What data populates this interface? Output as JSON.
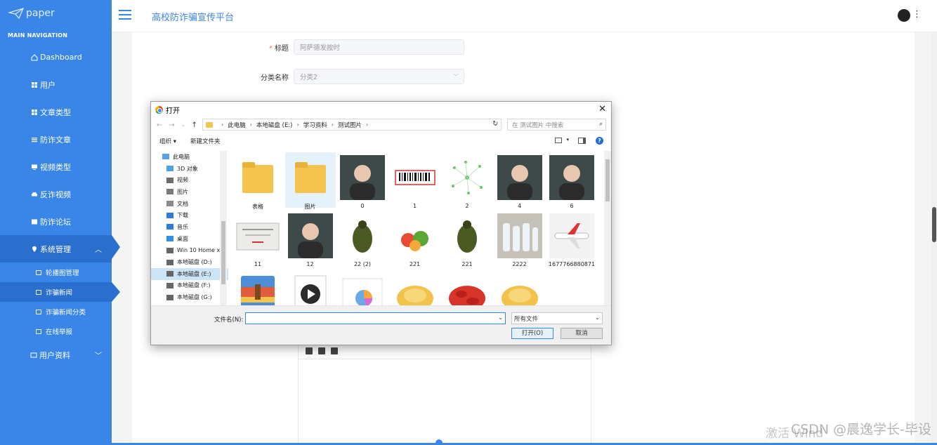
{
  "sidebar": {
    "brand": "paper",
    "nav_header": "MAIN NAVIGATION",
    "items": [
      {
        "label": "Dashboard"
      },
      {
        "label": "用户"
      },
      {
        "label": "文章类型"
      },
      {
        "label": "防诈文章"
      },
      {
        "label": "视频类型"
      },
      {
        "label": "反诈视频"
      },
      {
        "label": "防诈论坛"
      },
      {
        "label": "系统管理"
      }
    ],
    "sub_items": [
      {
        "label": "轮播图管理"
      },
      {
        "label": "诈骗新闻"
      },
      {
        "label": "诈骗新闻分类"
      },
      {
        "label": "在线举报"
      }
    ],
    "user_item": {
      "label": "用户资料"
    }
  },
  "topbar": {
    "title": "高校防诈骗宣传平台"
  },
  "form": {
    "title_label": "标题",
    "title_value": "阿萨德发按时",
    "category_label": "分类名称",
    "category_value": "分类2"
  },
  "dialog": {
    "title": "打开",
    "breadcrumbs": [
      "此电脑",
      "本地磁盘 (E:)",
      "学习资料",
      "测试图片"
    ],
    "search_placeholder": "在 测试图片 中搜索",
    "toolbar": {
      "organize": "组织 ▾",
      "new_folder": "新建文件夹"
    },
    "tree": [
      {
        "label": "此电脑",
        "icon": "computer-icon"
      },
      {
        "label": "3D 对象",
        "icon": "cube-icon"
      },
      {
        "label": "视频",
        "icon": "video-icon"
      },
      {
        "label": "图片",
        "icon": "image-icon"
      },
      {
        "label": "文档",
        "icon": "document-icon"
      },
      {
        "label": "下载",
        "icon": "download-icon"
      },
      {
        "label": "音乐",
        "icon": "music-icon"
      },
      {
        "label": "桌面",
        "icon": "desktop-icon"
      },
      {
        "label": "Win 10 Home x",
        "icon": "drive-icon"
      },
      {
        "label": "本地磁盘 (D:)",
        "icon": "drive-icon"
      },
      {
        "label": "本地磁盘 (E:)",
        "icon": "drive-icon"
      },
      {
        "label": "本地磁盘 (F:)",
        "icon": "drive-icon"
      },
      {
        "label": "本地磁盘 (G:)",
        "icon": "drive-icon"
      }
    ],
    "files": [
      {
        "name": "表格",
        "kind": "folder"
      },
      {
        "name": "图片",
        "kind": "folder"
      },
      {
        "name": "0",
        "kind": "portrait"
      },
      {
        "name": "1",
        "kind": "barcode"
      },
      {
        "name": "2",
        "kind": "graph"
      },
      {
        "name": "4",
        "kind": "portrait"
      },
      {
        "name": "6",
        "kind": "portrait"
      },
      {
        "name": "11",
        "kind": "certificate"
      },
      {
        "name": "12",
        "kind": "portrait"
      },
      {
        "name": "22 (2)",
        "kind": "beetle"
      },
      {
        "name": "221",
        "kind": "vegetables"
      },
      {
        "name": "221",
        "kind": "beetle"
      },
      {
        "name": "2222",
        "kind": "bottles"
      },
      {
        "name": "1677766880871",
        "kind": "airplane"
      },
      {
        "name": "",
        "kind": "archive"
      },
      {
        "name": "",
        "kind": "video"
      },
      {
        "name": "",
        "kind": "chart"
      },
      {
        "name": "",
        "kind": "food"
      },
      {
        "name": "",
        "kind": "crayfish"
      },
      {
        "name": "",
        "kind": "food"
      }
    ],
    "filename_label": "文件名(N):",
    "filetype_value": "所有文件",
    "open_button": "打开(O)",
    "cancel_button": "取消"
  },
  "overlay": {
    "watermark": "CSDN @晨逸学长-毕设",
    "activate_text": "激活 Wind"
  },
  "colors": {
    "accent": "#3a86e8",
    "sidebar_active": "#2a6fce"
  }
}
